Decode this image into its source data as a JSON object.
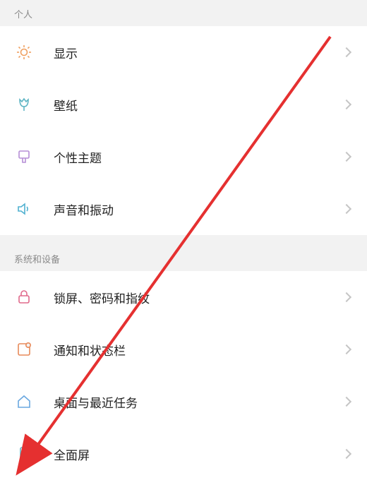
{
  "sections": [
    {
      "header": "个人",
      "items": [
        {
          "icon": "brightness",
          "label": "显示"
        },
        {
          "icon": "tulip",
          "label": "壁纸"
        },
        {
          "icon": "brush",
          "label": "个性主题"
        },
        {
          "icon": "volume",
          "label": "声音和振动"
        }
      ]
    },
    {
      "header": "系统和设备",
      "items": [
        {
          "icon": "lock",
          "label": "锁屏、密码和指纹"
        },
        {
          "icon": "notification",
          "label": "通知和状态栏"
        },
        {
          "icon": "home",
          "label": "桌面与最近任务"
        },
        {
          "icon": "phone",
          "label": "全面屏"
        }
      ]
    }
  ],
  "icon_colors": {
    "brightness": "#f0a060",
    "tulip": "#5fb5c4",
    "brush": "#b58ed6",
    "volume": "#4fb0d0",
    "lock": "#e06a8c",
    "notification": "#e88a5a",
    "home": "#6aa8e0",
    "phone": "#5fb5c4"
  },
  "annotation_arrow_color": "#e53030"
}
